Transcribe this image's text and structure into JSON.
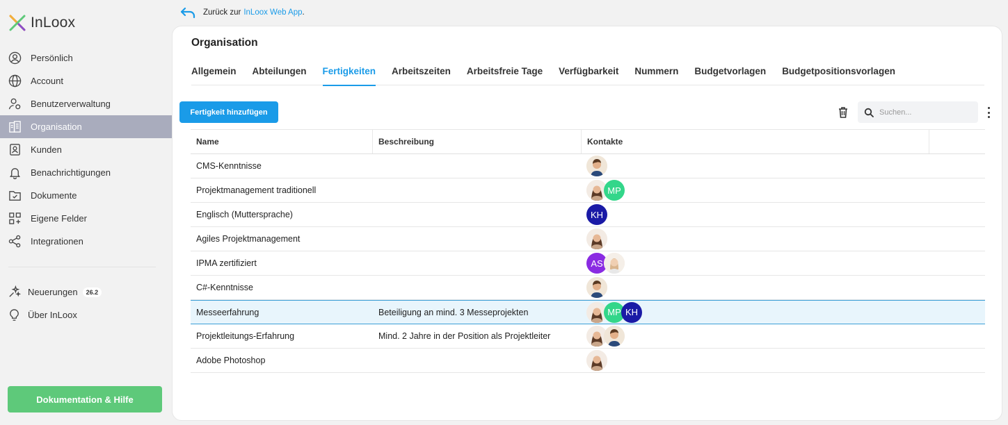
{
  "app": {
    "logo_text": "InLoox"
  },
  "back": {
    "prefix": "Zurück zur",
    "link": "InLoox Web App",
    "suffix": "."
  },
  "sidebar": {
    "items": [
      {
        "label": "Persönlich",
        "icon": "user-circle-icon"
      },
      {
        "label": "Account",
        "icon": "globe-icon"
      },
      {
        "label": "Benutzerverwaltung",
        "icon": "user-settings-icon"
      },
      {
        "label": "Organisation",
        "icon": "building-icon",
        "active": true
      },
      {
        "label": "Kunden",
        "icon": "contact-card-icon"
      },
      {
        "label": "Benachrichtigungen",
        "icon": "bell-icon"
      },
      {
        "label": "Dokumente",
        "icon": "folder-check-icon"
      },
      {
        "label": "Eigene Felder",
        "icon": "grid-plus-icon"
      },
      {
        "label": "Integrationen",
        "icon": "share-nodes-icon"
      }
    ],
    "secondary": [
      {
        "label": "Neuerungen",
        "badge": "26.2",
        "icon": "sparkles-icon"
      },
      {
        "label": "Über InLoox",
        "icon": "lightbulb-icon"
      }
    ],
    "help_button": "Dokumentation & Hilfe"
  },
  "page": {
    "title": "Organisation",
    "tabs": [
      "Allgemein",
      "Abteilungen",
      "Fertigkeiten",
      "Arbeitszeiten",
      "Arbeitsfreie Tage",
      "Verfügbarkeit",
      "Nummern",
      "Budgetvorlagen",
      "Budgetpositionsvorlagen"
    ],
    "active_tab": "Fertigkeiten",
    "add_button": "Fertigkeit hinzufügen",
    "search_placeholder": "Suchen..."
  },
  "table": {
    "columns": [
      "Name",
      "Beschreibung",
      "Kontakte"
    ],
    "rows": [
      {
        "name": "CMS-Kenntnisse",
        "description": "",
        "contacts": [
          "photo-man"
        ]
      },
      {
        "name": "Projektmanagement traditionell",
        "description": "",
        "contacts": [
          "photo-woman",
          "MP"
        ]
      },
      {
        "name": "Englisch (Muttersprache)",
        "description": "",
        "contacts": [
          "KH"
        ]
      },
      {
        "name": "Agiles Projektmanagement",
        "description": "",
        "contacts": [
          "photo-woman"
        ]
      },
      {
        "name": "IPMA zertifiziert",
        "description": "",
        "contacts": [
          "AS",
          "photo-woman-2"
        ]
      },
      {
        "name": "C#-Kenntnisse",
        "description": "",
        "contacts": [
          "photo-man"
        ]
      },
      {
        "name": "Messeerfahrung",
        "description": "Beteiligung an mind. 3 Messeprojekten",
        "contacts": [
          "photo-woman",
          "MP",
          "KH"
        ],
        "selected": true
      },
      {
        "name": "Projektleitungs-Erfahrung",
        "description": "Mind. 2 Jahre in der Position als Projektleiter",
        "contacts": [
          "photo-woman",
          "photo-man"
        ]
      },
      {
        "name": "Adobe Photoshop",
        "description": "",
        "contacts": [
          "photo-woman"
        ]
      }
    ]
  },
  "colors": {
    "accent": "#1a9be8",
    "help_green": "#5ec97a",
    "sidebar_active": "#a9acbd",
    "avatar_MP": "#33d68a",
    "avatar_KH": "#1a1aa6",
    "avatar_AS": "#8a2be2"
  }
}
